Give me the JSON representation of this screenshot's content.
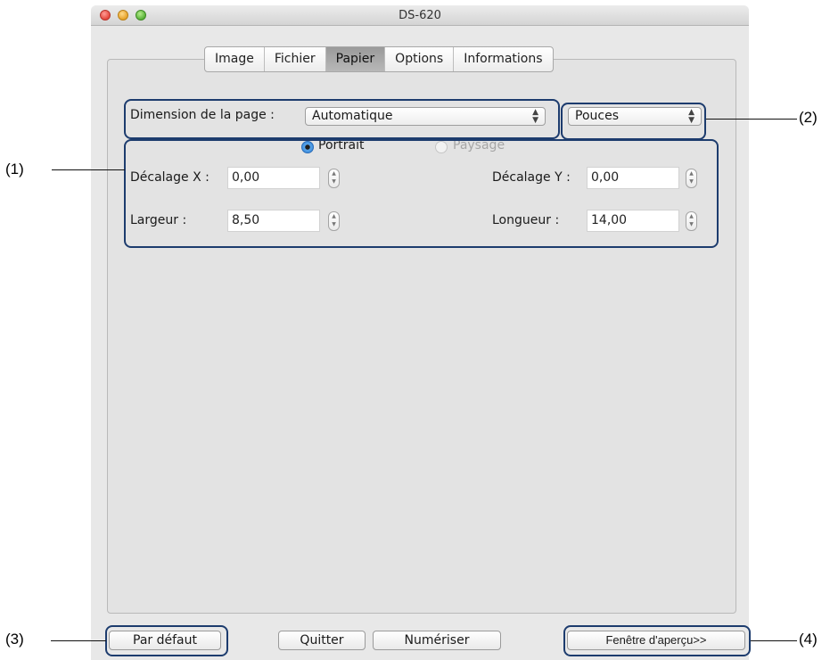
{
  "window": {
    "title": "DS-620"
  },
  "tabs": [
    {
      "label": "Image",
      "active": false
    },
    {
      "label": "Fichier",
      "active": false
    },
    {
      "label": "Papier",
      "active": true
    },
    {
      "label": "Options",
      "active": false
    },
    {
      "label": "Informations",
      "active": false
    }
  ],
  "page_size": {
    "label": "Dimension de la page :",
    "value": "Automatique"
  },
  "units": {
    "value": "Pouces"
  },
  "orientation": {
    "portrait": "Portrait",
    "landscape": "Paysage",
    "selected": "Portrait"
  },
  "offset_x": {
    "label": "Décalage X :",
    "value": "0,00"
  },
  "offset_y": {
    "label": "Décalage Y :",
    "value": "0,00"
  },
  "width": {
    "label": "Largeur :",
    "value": "8,50"
  },
  "length": {
    "label": "Longueur :",
    "value": "14,00"
  },
  "buttons": {
    "default": "Par défaut",
    "quit": "Quitter",
    "scan": "Numériser",
    "preview": "Fenêtre d'aperçu>>"
  },
  "callouts": {
    "c1": "(1)",
    "c2": "(2)",
    "c3": "(3)",
    "c4": "(4)"
  },
  "colors": {
    "highlight": "#1d3c6e",
    "radio_selected": "#2f7fd6"
  }
}
